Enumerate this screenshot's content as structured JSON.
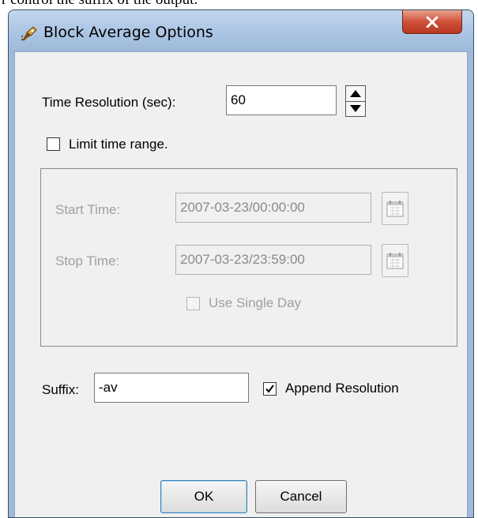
{
  "caption": "r control the suffix of the output.",
  "window": {
    "title": "Block Average Options",
    "app_icon": "rocket-app-icon",
    "close_icon": "close-icon"
  },
  "time_resolution": {
    "label": "Time Resolution (sec):",
    "value": "60",
    "spinner_icon": "spinner-arrows-icon"
  },
  "limit_time_range": {
    "label": "Limit time range.",
    "checked": false
  },
  "time_range_group": {
    "start_label": "Start Time:",
    "start_value": "2007-03-23/00:00:00",
    "stop_label": "Stop Time:",
    "stop_value": "2007-03-23/23:59:00",
    "calendar_icon": "calendar-icon",
    "single_day_label": "Use Single Day",
    "single_day_checked": false,
    "enabled": false
  },
  "suffix": {
    "label": "Suffix:",
    "value": "-av",
    "append_label": "Append Resolution",
    "append_checked": true
  },
  "buttons": {
    "ok": "OK",
    "cancel": "Cancel"
  },
  "colors": {
    "titlebar": "#a9c3e3",
    "close_button": "#d0513a",
    "client_background": "#f0f0f0",
    "disabled_text": "#a0a0a0"
  }
}
